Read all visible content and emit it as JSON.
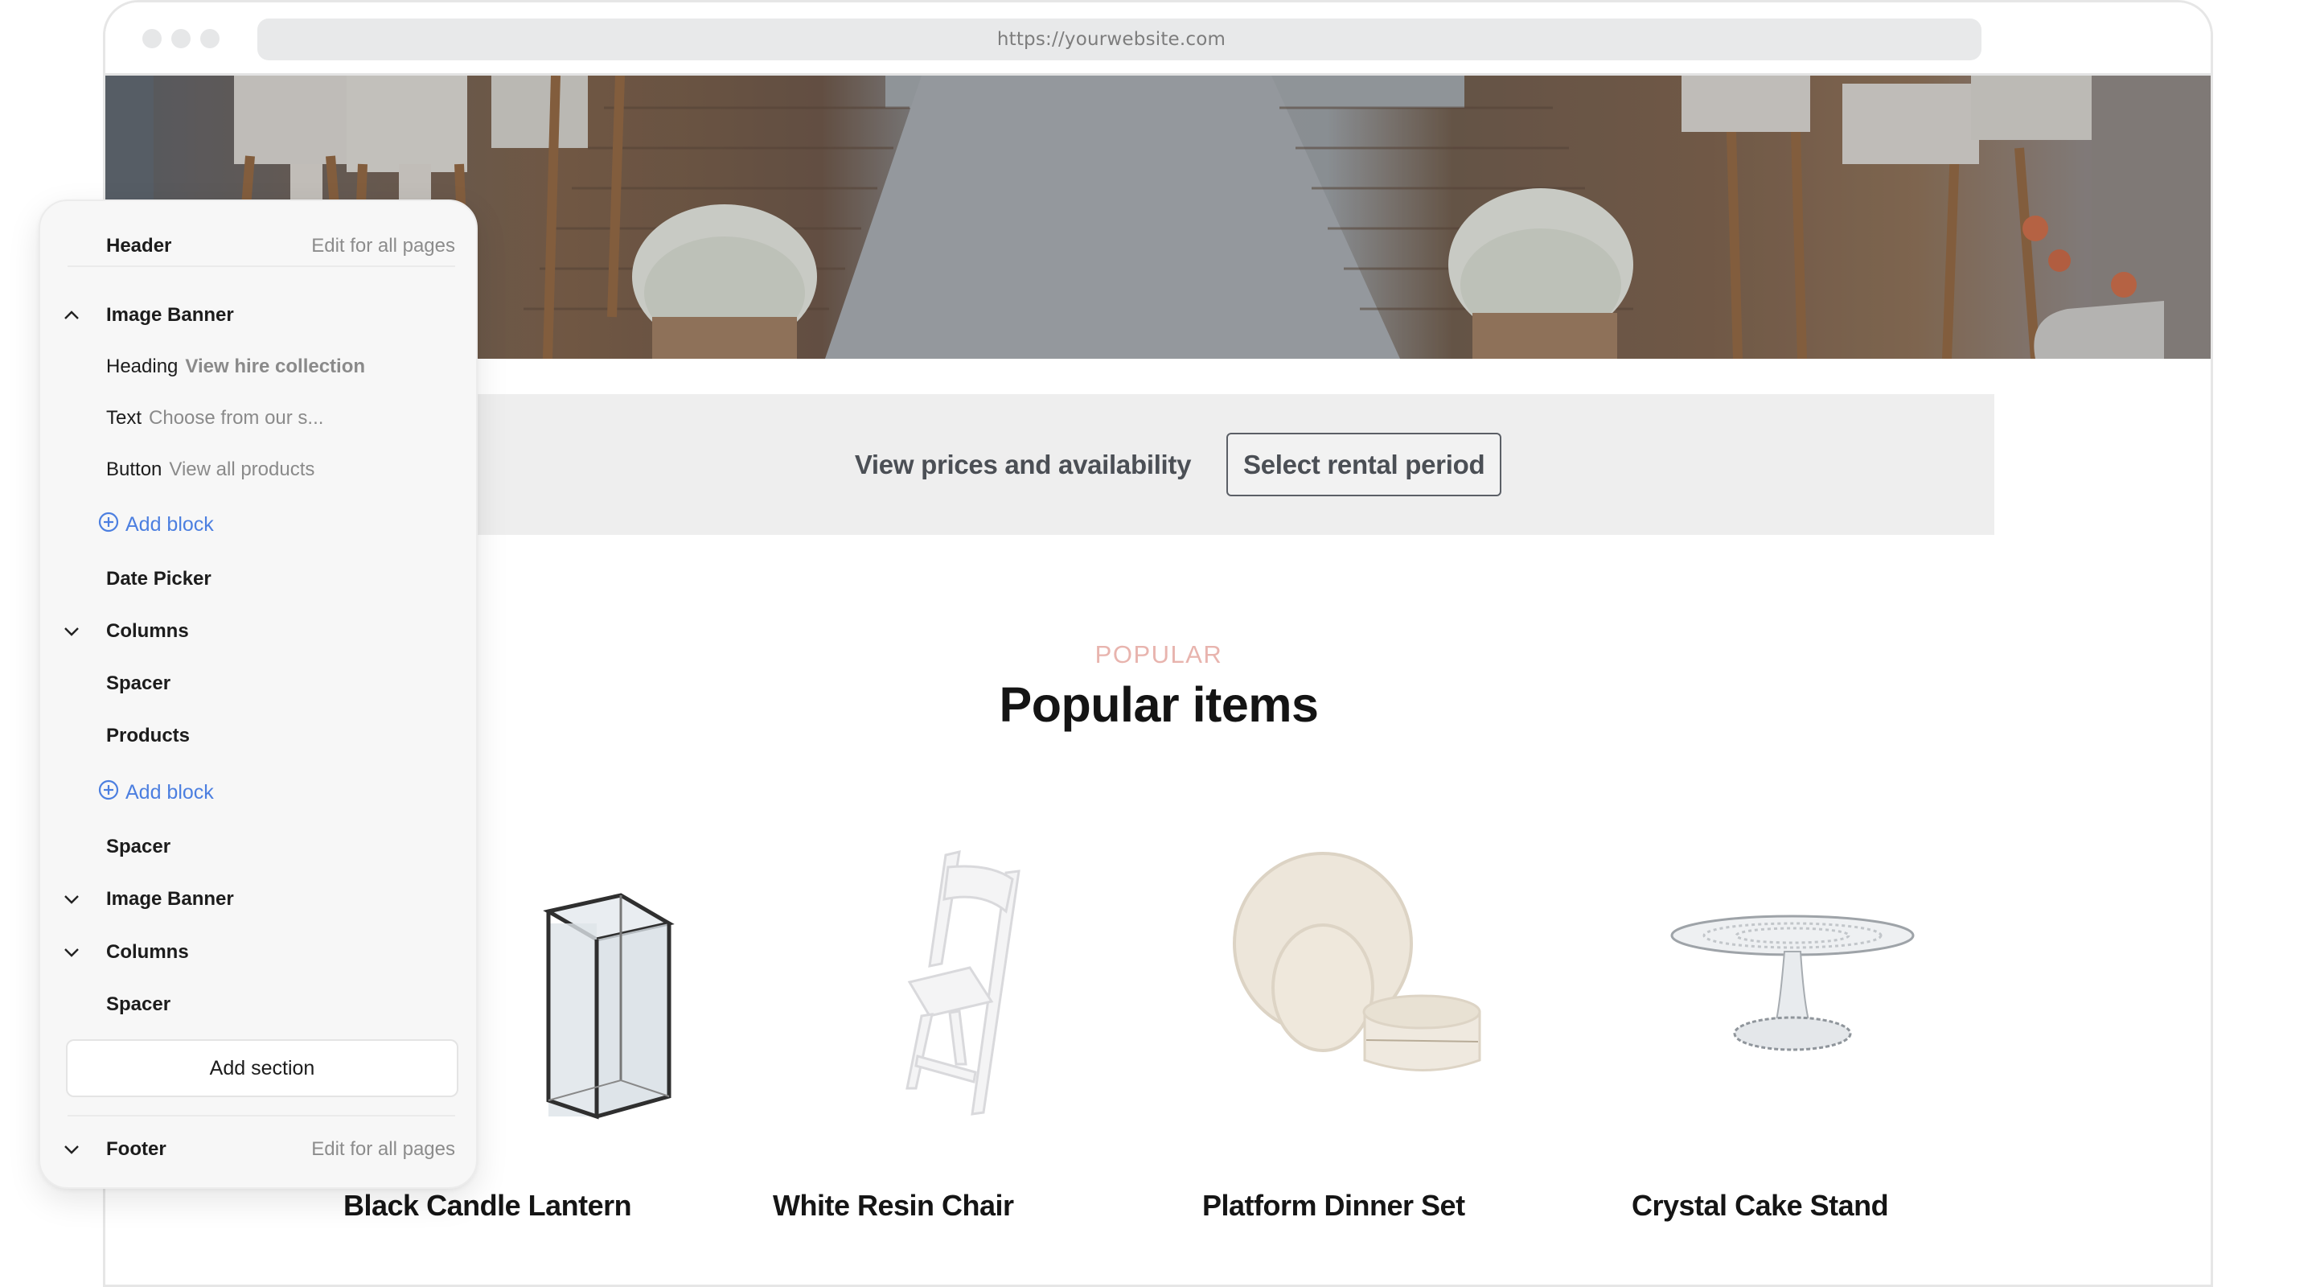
{
  "browser": {
    "url": "https://yourwebsite.com"
  },
  "banner": {
    "alt": "Wedding aisle with white runner, wooden chairs and white flower planters"
  },
  "date_picker": {
    "prompt": "View prices and availability",
    "button_label": "Select rental period"
  },
  "popular": {
    "eyebrow": "POPULAR",
    "title": "Popular items",
    "accent_color": "#e8b4ae",
    "products": [
      {
        "name": "Black Candle Lantern",
        "image": "glass-lantern"
      },
      {
        "name": "White Resin Chair",
        "image": "folding-chair"
      },
      {
        "name": "Platform Dinner Set",
        "image": "dinner-set"
      },
      {
        "name": "Crystal Cake Stand",
        "image": "cake-stand"
      }
    ]
  },
  "panel": {
    "header": {
      "label": "Header",
      "action": "Edit for all pages"
    },
    "sections": [
      {
        "label": "Image Banner",
        "chevron": "up"
      },
      {
        "key": "Heading",
        "value": "View hire collection"
      },
      {
        "key": "Text",
        "value": "Choose from our s..."
      },
      {
        "key": "Button",
        "value": "View all products"
      },
      {
        "add_block": "Add block"
      },
      {
        "label": "Date Picker"
      },
      {
        "label": "Columns",
        "chevron": "down"
      },
      {
        "label": "Spacer"
      },
      {
        "label": "Products"
      },
      {
        "add_block": "Add block"
      },
      {
        "label": "Spacer"
      },
      {
        "label": "Image Banner",
        "chevron": "down"
      },
      {
        "label": "Columns",
        "chevron": "down"
      },
      {
        "label": "Spacer"
      }
    ],
    "add_section_label": "Add section",
    "footer": {
      "label": "Footer",
      "action": "Edit for all pages",
      "chevron": "down"
    },
    "link_color": "#4c7fe0"
  }
}
